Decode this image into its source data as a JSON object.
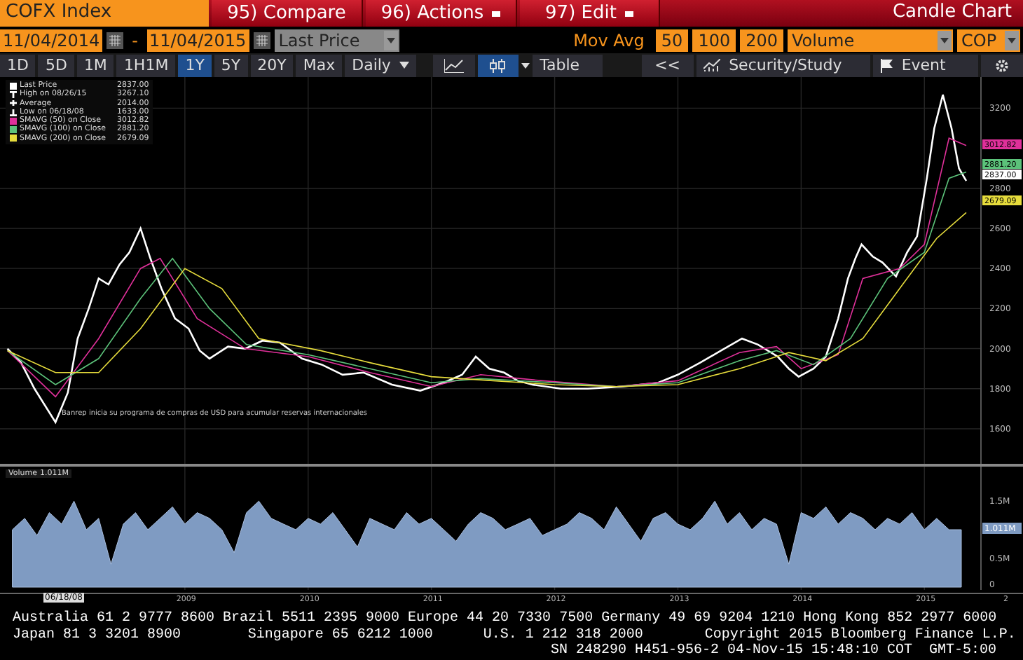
{
  "header": {
    "security": "COFX Index",
    "buttons": [
      {
        "label": "95) Compare",
        "dropdown": false
      },
      {
        "label": "96) Actions",
        "dropdown": true
      },
      {
        "label": "97) Edit",
        "dropdown": true
      }
    ],
    "chart_type": "Candle Chart"
  },
  "range": {
    "start": "11/04/2014",
    "separator": "-",
    "end": "11/04/2015",
    "field": "Last Price"
  },
  "studies": {
    "label": "Mov Avg",
    "periods": [
      "50",
      "100",
      "200"
    ],
    "lower": "Volume",
    "currency": "COP"
  },
  "periods": [
    {
      "label": "1D",
      "selected": false
    },
    {
      "label": "5D",
      "selected": false
    },
    {
      "label": "1M",
      "selected": false
    },
    {
      "label": "1H1M",
      "selected": false
    },
    {
      "label": "1Y",
      "selected": true
    },
    {
      "label": "5Y",
      "selected": false
    },
    {
      "label": "20Y",
      "selected": false
    },
    {
      "label": "Max",
      "selected": false
    }
  ],
  "frequency": "Daily",
  "chart_styles": [
    {
      "kind": "line",
      "selected": false
    },
    {
      "kind": "candle",
      "selected": true
    }
  ],
  "tools": [
    {
      "kind": "table",
      "label": "Table"
    },
    {
      "kind": "collapse",
      "label": "<<"
    },
    {
      "kind": "study",
      "label": "Security/Study"
    },
    {
      "kind": "event",
      "label": "Event"
    },
    {
      "kind": "settings"
    }
  ],
  "price_chart": {
    "legend": [
      {
        "kind": "last",
        "value": "2837.00"
      },
      {
        "kind": "high",
        "label": "High on 08/26/15",
        "value": "3267.10",
        "color": "#ffffff"
      },
      {
        "kind": "average",
        "label": "Average",
        "value": "2014.00",
        "color": "#ffffff"
      },
      {
        "kind": "low",
        "label": "Low on 06/18/08",
        "value": "1633.00",
        "color": "#ffffff"
      },
      {
        "kind": "study",
        "value": "3012.82"
      },
      {
        "kind": "study",
        "value": "2881.20"
      },
      {
        "kind": "study",
        "value": "2679.09"
      }
    ],
    "annotation": "Banrep inicia su programa de compras de USD para acumular reservas internacionales",
    "tags": [
      {
        "value": "3012.82",
        "color": "#e0309a"
      },
      {
        "value": "2881.20",
        "color": "#5cc27a"
      },
      {
        "value": "2837.00",
        "color": "#ffffff"
      },
      {
        "value": "2679.09",
        "color": "#e6dc3c"
      }
    ],
    "chart_data": {
      "type": "line",
      "xlim": [
        2008,
        2016.3
      ],
      "ylim": [
        1425,
        3355
      ],
      "grid": true,
      "legend": "top-left",
      "yticks": [
        {
          "value": 3200,
          "label": "3200"
        },
        {
          "value": 2800,
          "label": "2800"
        },
        {
          "value": 2600,
          "label": "2600"
        },
        {
          "value": 2400,
          "label": "2400"
        },
        {
          "value": 2200,
          "label": "2200"
        },
        {
          "value": 2000,
          "label": "2000"
        },
        {
          "value": 1800,
          "label": "1800"
        },
        {
          "value": 1600,
          "label": "1600"
        }
      ],
      "series": [
        {
          "name": "Last Price",
          "color": "#ffffff",
          "x": [
            2008.06,
            2008.17,
            2008.28,
            2008.45,
            2008.55,
            2008.63,
            2008.72,
            2008.8,
            2008.88,
            2008.97,
            2009.05,
            2009.14,
            2009.22,
            2009.31,
            2009.42,
            2009.53,
            2009.62,
            2009.7,
            2009.85,
            2009.99,
            2010.13,
            2010.27,
            2010.45,
            2010.61,
            2010.78,
            2010.95,
            2011.18,
            2011.41,
            2011.6,
            2011.75,
            2011.86,
            2011.97,
            2012.09,
            2012.2,
            2012.32,
            2012.55,
            2012.77,
            2013.05,
            2013.34,
            2013.5,
            2013.68,
            2013.85,
            2014.02,
            2014.15,
            2014.31,
            2014.4,
            2014.48,
            2014.6,
            2014.7,
            2014.8,
            2014.88,
            2014.94,
            2014.99,
            2015.08,
            2015.16,
            2015.27,
            2015.36,
            2015.44,
            2015.52,
            2015.58,
            2015.65,
            2015.72,
            2015.78,
            2015.84
          ],
          "values": [
            2000,
            1930,
            1800,
            1633,
            1780,
            2050,
            2200,
            2350,
            2320,
            2420,
            2480,
            2600,
            2450,
            2300,
            2150,
            2100,
            1990,
            1950,
            2010,
            2000,
            2040,
            2030,
            1950,
            1920,
            1870,
            1880,
            1820,
            1790,
            1830,
            1870,
            1960,
            1900,
            1880,
            1840,
            1820,
            1800,
            1800,
            1810,
            1830,
            1870,
            1930,
            1990,
            2050,
            2020,
            1960,
            1900,
            1860,
            1900,
            1960,
            2150,
            2350,
            2450,
            2520,
            2460,
            2430,
            2360,
            2480,
            2560,
            2850,
            3100,
            3267,
            3100,
            2900,
            2837
          ]
        },
        {
          "name": "SMAVG (50) on Close",
          "color": "#e0309a",
          "x": [
            2008.06,
            2008.45,
            2008.8,
            2009.14,
            2009.3,
            2009.6,
            2009.99,
            2010.5,
            2011.0,
            2011.5,
            2011.9,
            2012.4,
            2013.0,
            2013.5,
            2014.0,
            2014.3,
            2014.5,
            2014.8,
            2015.0,
            2015.3,
            2015.5,
            2015.7,
            2015.84
          ],
          "values": [
            1990,
            1760,
            2050,
            2400,
            2450,
            2150,
            2000,
            1960,
            1880,
            1810,
            1870,
            1840,
            1810,
            1840,
            1980,
            2010,
            1900,
            1970,
            2350,
            2400,
            2520,
            3050,
            3013
          ]
        },
        {
          "name": "SMAVG (100) on Close",
          "color": "#5cc27a",
          "x": [
            2008.06,
            2008.45,
            2008.8,
            2009.14,
            2009.4,
            2009.7,
            2010.0,
            2010.5,
            2011.0,
            2011.5,
            2011.9,
            2012.5,
            2013.0,
            2013.5,
            2014.0,
            2014.3,
            2014.6,
            2014.9,
            2015.2,
            2015.5,
            2015.7,
            2015.84
          ],
          "values": [
            1990,
            1820,
            1950,
            2250,
            2450,
            2200,
            2020,
            1970,
            1900,
            1830,
            1850,
            1830,
            1810,
            1830,
            1940,
            1990,
            1920,
            2050,
            2350,
            2480,
            2850,
            2881
          ]
        },
        {
          "name": "SMAVG (200) on Close",
          "color": "#e6dc3c",
          "x": [
            2008.06,
            2008.45,
            2008.8,
            2009.14,
            2009.5,
            2009.8,
            2010.1,
            2010.6,
            2011.0,
            2011.5,
            2012.0,
            2012.5,
            2013.0,
            2013.5,
            2014.0,
            2014.4,
            2014.7,
            2015.0,
            2015.3,
            2015.6,
            2015.84
          ],
          "values": [
            1990,
            1880,
            1880,
            2100,
            2400,
            2300,
            2050,
            1990,
            1930,
            1860,
            1840,
            1820,
            1810,
            1820,
            1900,
            1980,
            1940,
            2050,
            2300,
            2550,
            2679
          ]
        }
      ]
    }
  },
  "volume_chart": {
    "legend_value": "1.011M",
    "tag": "1.011M",
    "cursor_date": "06/18/08",
    "cut_label": "2",
    "chart_data": {
      "type": "area",
      "xlim": [
        2008,
        2016.3
      ],
      "ylim": [
        0,
        2.1
      ],
      "grid": true,
      "legend": "top-left",
      "yticks": [
        {
          "value": 1.5,
          "label": "1.5M"
        },
        {
          "value": 0.5,
          "label": "0.5M"
        },
        {
          "value": 0,
          "label": "0"
        }
      ],
      "xticks": [
        {
          "value": 2009.5,
          "label": "2009"
        },
        {
          "value": 2010.5,
          "label": "2010"
        },
        {
          "value": 2011.5,
          "label": "2011"
        },
        {
          "value": 2012.5,
          "label": "2012"
        },
        {
          "value": 2013.5,
          "label": "2013"
        },
        {
          "value": 2014.5,
          "label": "2014"
        },
        {
          "value": 2015.5,
          "label": "2015"
        }
      ],
      "series": [
        {
          "name": "Volume",
          "color": "#7f9bc2",
          "x": [
            2008.1,
            2008.2,
            2008.3,
            2008.4,
            2008.5,
            2008.6,
            2008.7,
            2008.8,
            2008.9,
            2009.0,
            2009.1,
            2009.2,
            2009.3,
            2009.4,
            2009.5,
            2009.6,
            2009.7,
            2009.8,
            2009.9,
            2010.0,
            2010.1,
            2010.2,
            2010.3,
            2010.4,
            2010.5,
            2010.6,
            2010.7,
            2010.8,
            2010.9,
            2011.0,
            2011.1,
            2011.2,
            2011.3,
            2011.4,
            2011.5,
            2011.6,
            2011.7,
            2011.8,
            2011.9,
            2012.0,
            2012.1,
            2012.2,
            2012.3,
            2012.4,
            2012.5,
            2012.6,
            2012.7,
            2012.8,
            2012.9,
            2013.0,
            2013.1,
            2013.2,
            2013.3,
            2013.4,
            2013.5,
            2013.6,
            2013.7,
            2013.8,
            2013.9,
            2014.0,
            2014.1,
            2014.2,
            2014.3,
            2014.4,
            2014.5,
            2014.6,
            2014.7,
            2014.8,
            2014.9,
            2015.0,
            2015.1,
            2015.2,
            2015.3,
            2015.4,
            2015.5,
            2015.6,
            2015.7,
            2015.8
          ],
          "values": [
            1.0,
            1.2,
            0.9,
            1.3,
            1.1,
            1.5,
            1.0,
            1.2,
            0.4,
            1.1,
            1.3,
            1.0,
            1.2,
            1.4,
            1.1,
            1.3,
            1.2,
            1.0,
            0.6,
            1.3,
            1.5,
            1.2,
            1.1,
            1.0,
            1.2,
            1.1,
            1.3,
            1.0,
            0.7,
            1.2,
            1.1,
            1.0,
            1.3,
            1.1,
            1.2,
            1.0,
            0.8,
            1.1,
            1.3,
            1.2,
            1.0,
            1.1,
            1.2,
            0.9,
            1.0,
            1.1,
            1.3,
            1.2,
            1.0,
            1.4,
            1.1,
            0.8,
            1.2,
            1.3,
            1.1,
            1.0,
            1.2,
            1.5,
            1.1,
            1.3,
            1.0,
            1.2,
            1.1,
            0.4,
            1.3,
            1.2,
            1.4,
            1.1,
            1.3,
            1.2,
            1.0,
            1.2,
            1.1,
            1.3,
            1.0,
            1.2,
            1.0,
            1.0
          ]
        }
      ]
    }
  },
  "footer": {
    "line_1": "Australia 61 2 9777 8600 Brazil 5511 2395 9000 Europe 44 20 7330 7500 Germany 49 69 9204 1210 Hong Kong 852 2977 6000",
    "line_2": [
      "Japan 81 3 3201 8900",
      "Singapore 65 6212 1000",
      "U.S. 1 212 318 2000",
      "Copyright 2015 Bloomberg Finance L.P."
    ],
    "line_3": "SN 248290 H451-956-2 04-Nov-15 15:48:10 COT  GMT-5:00"
  }
}
